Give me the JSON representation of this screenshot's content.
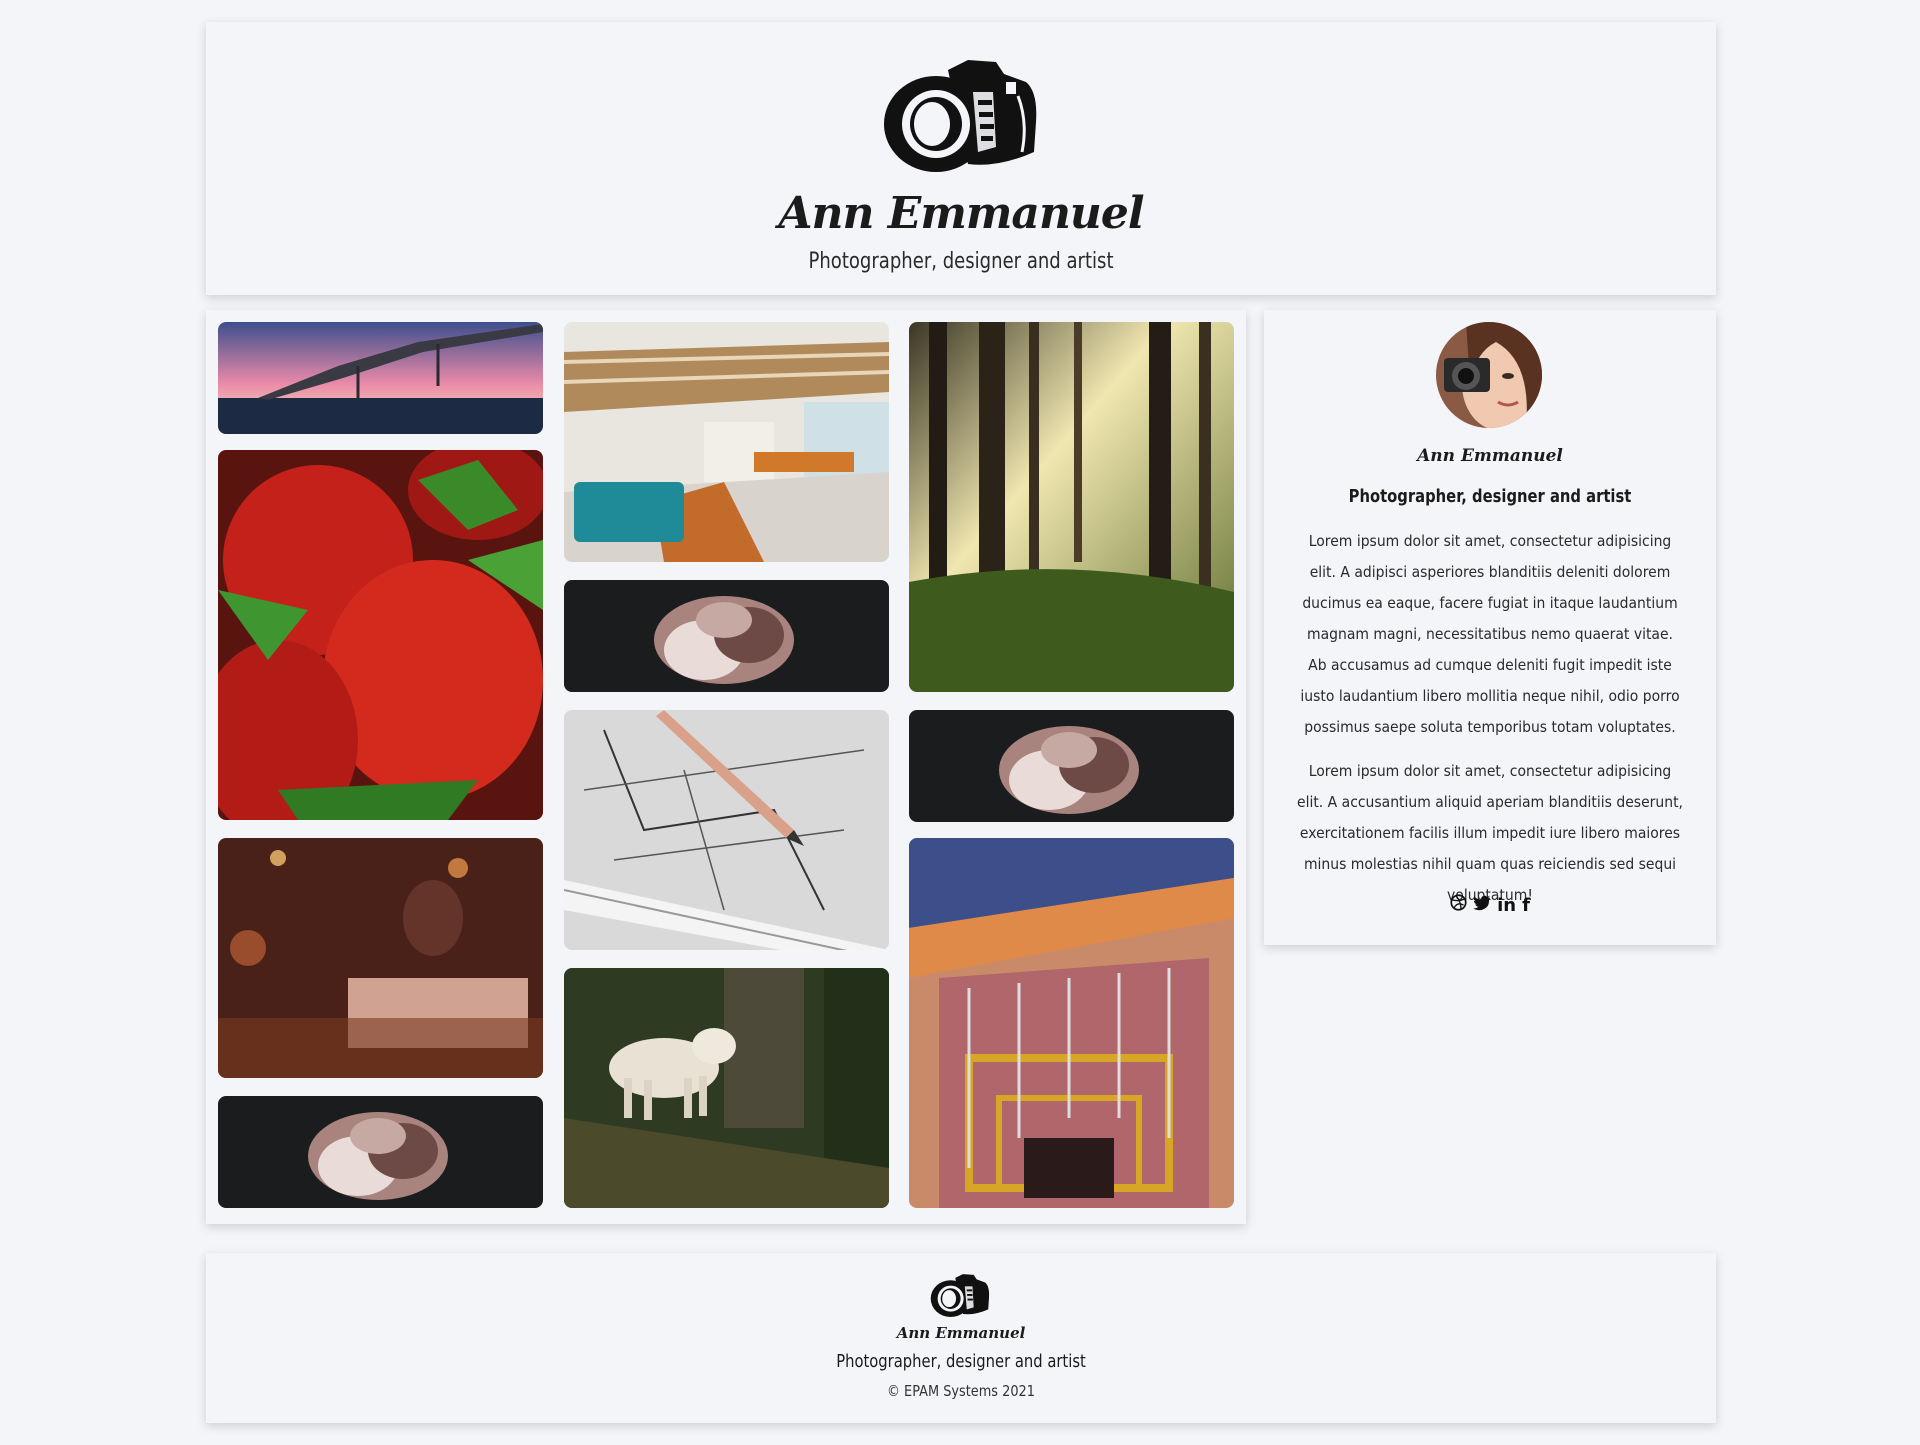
{
  "header": {
    "logo_icon": "camera-icon",
    "name": "Ann Emmanuel",
    "tagline": "Photographer, designer and artist"
  },
  "gallery": {
    "photos": [
      {
        "name": "bridge-photo",
        "subject": "bridge at sunset"
      },
      {
        "name": "strawberries-photo",
        "subject": "strawberries"
      },
      {
        "name": "cafe-person-photo",
        "subject": "person in cafe"
      },
      {
        "name": "peony-photo-1",
        "subject": "peony on dark"
      },
      {
        "name": "office-lobby-photo",
        "subject": "office lobby"
      },
      {
        "name": "peony-photo-2",
        "subject": "peony on dark"
      },
      {
        "name": "drawing-pencil-photo",
        "subject": "technical drawing with pencil"
      },
      {
        "name": "wolf-photo",
        "subject": "white wolf in forest"
      },
      {
        "name": "forest-photo",
        "subject": "sunlit forest"
      },
      {
        "name": "peony-photo-3",
        "subject": "peony on dark"
      },
      {
        "name": "staircase-photo",
        "subject": "spiral staircase"
      }
    ]
  },
  "profile": {
    "avatar_icon": "avatar",
    "name": "Ann Emmanuel",
    "title": "Photographer, designer and artist",
    "paragraph1": "Lorem ipsum dolor sit amet, consectetur adipisicing elit. A adipisci asperiores blanditiis deleniti dolorem ducimus ea eaque, facere fugiat in itaque laudantium magnam magni, necessitatibus nemo quaerat vitae. Ab accusamus ad cumque deleniti fugit impedit iste iusto laudantium libero mollitia neque nihil, odio porro possimus saepe soluta temporibus totam voluptates.",
    "paragraph2": "Lorem ipsum dolor sit amet, consectetur adipisicing elit. A accusantium aliquid aperiam blanditiis deserunt, exercitationem facilis illum impedit iure libero maiores minus molestias nihil quam quas reiciendis sed sequi voluptatum!",
    "social": {
      "dribbble_icon": "dribbble-icon",
      "twitter_icon": "twitter-icon",
      "linkedin_label": "in",
      "facebook_label": "f"
    }
  },
  "footer": {
    "logo_icon": "camera-icon",
    "name": "Ann Emmanuel",
    "tagline": "Photographer, designer and artist",
    "copyright": "© EPAM Systems 2021"
  },
  "colors": {
    "background": "#f4f5f9",
    "text": "#1b1b1b"
  }
}
